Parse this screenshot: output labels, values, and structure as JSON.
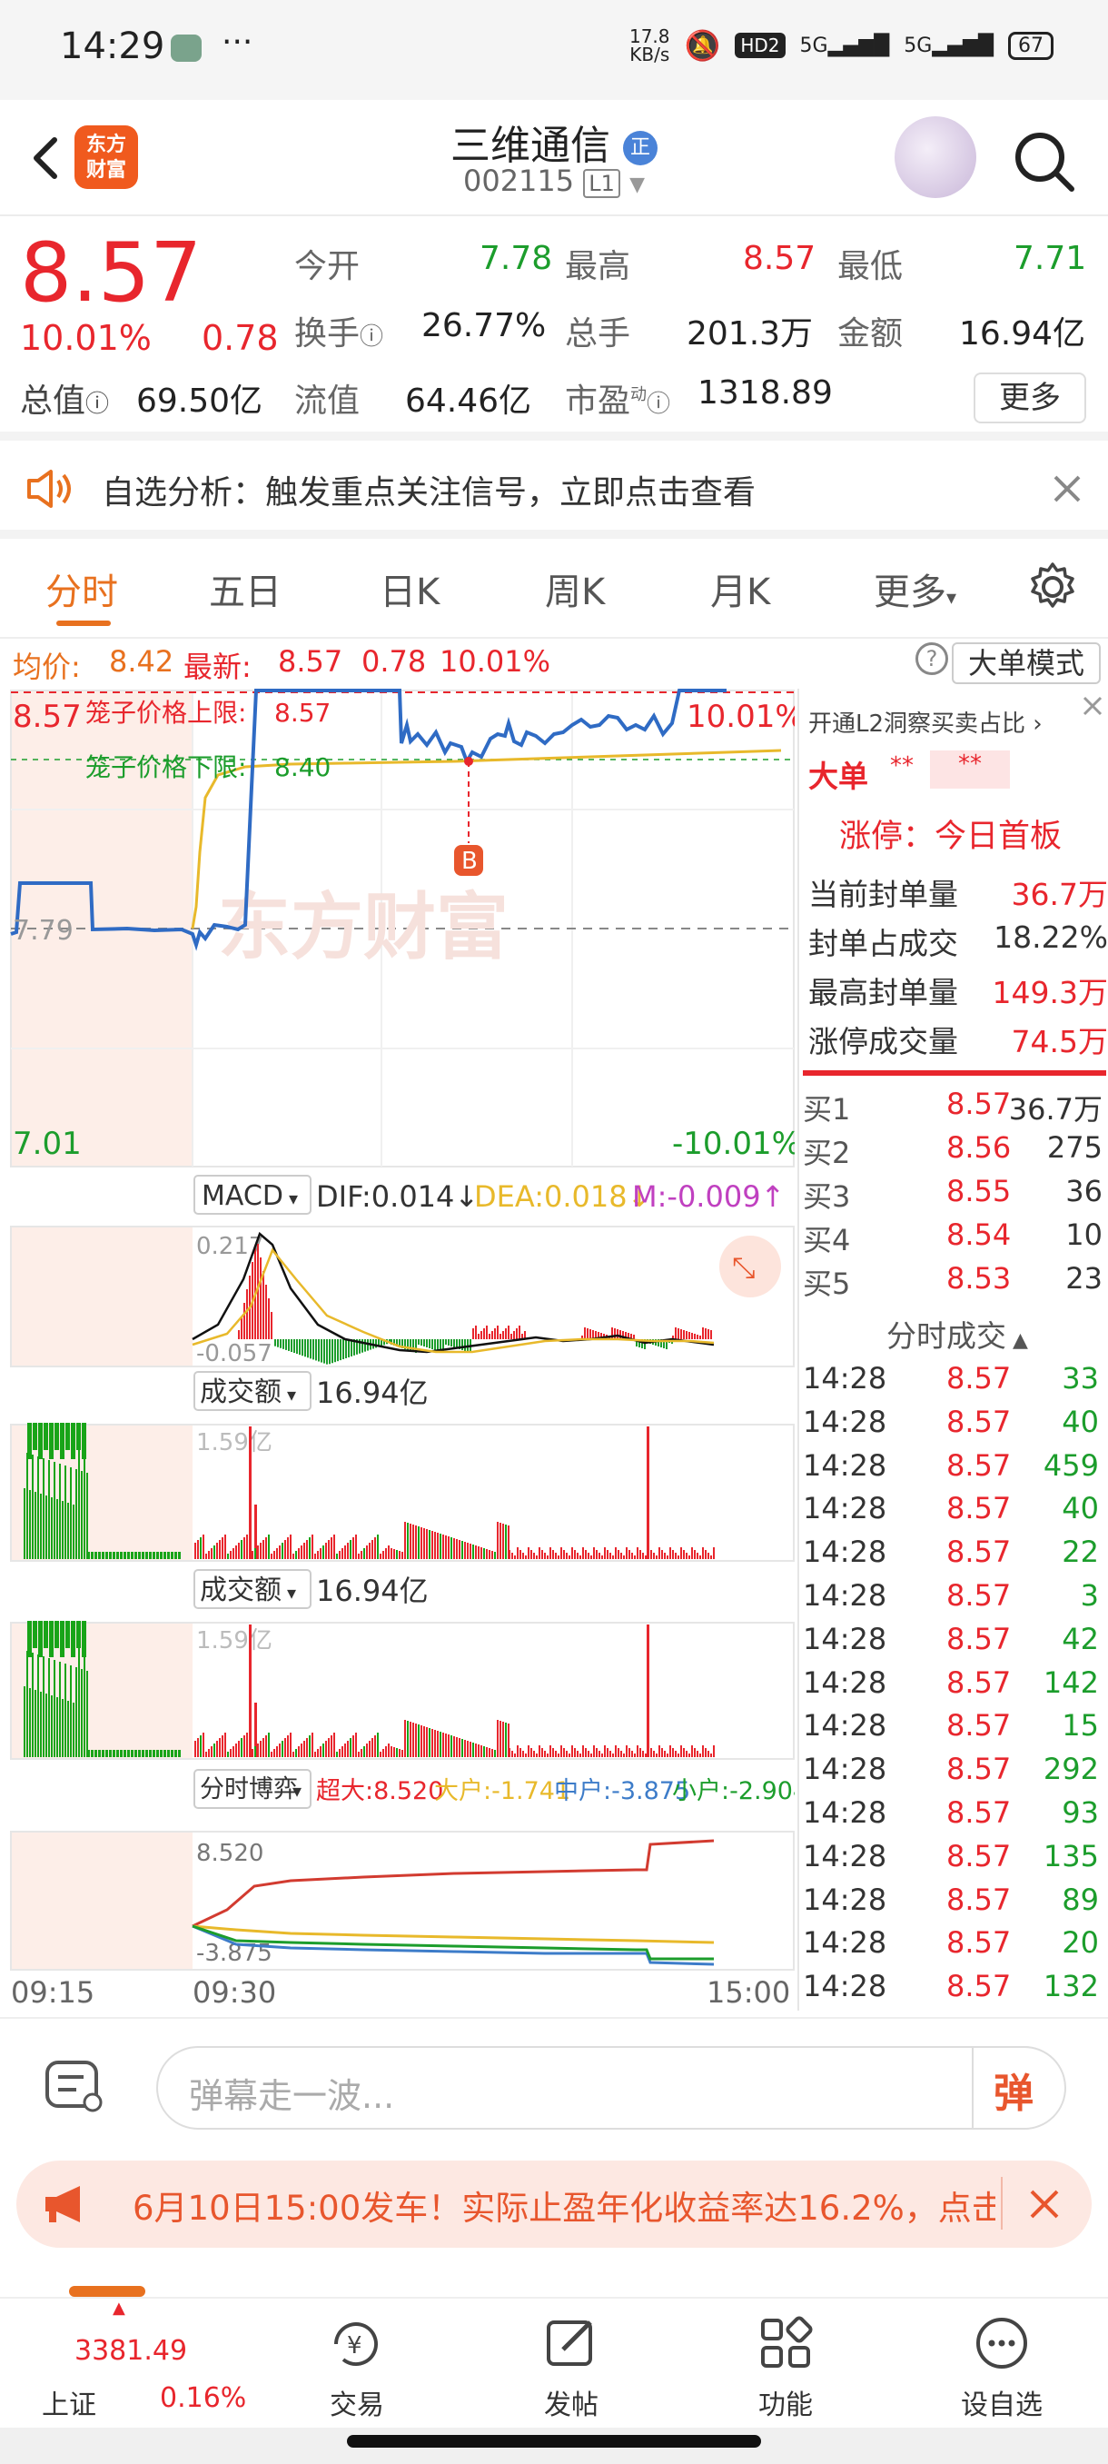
{
  "status_bar": {
    "time": "14:29",
    "net_speed_top": "17.8",
    "net_speed_bottom": "KB/s",
    "hd": "HD2",
    "signal1": "5G",
    "signal2": "5G",
    "battery": "67"
  },
  "header": {
    "logo_text_1": "东方",
    "logo_text_2": "财富",
    "stock_name": "三维通信",
    "stock_code": "002115",
    "level": "L1"
  },
  "quote": {
    "price": "8.57",
    "change_pct": "10.01%",
    "change": "0.78",
    "open_label": "今开",
    "open": "7.78",
    "high_label": "最高",
    "high": "8.57",
    "low_label": "最低",
    "low": "7.71",
    "turnover_label": "换手",
    "turnover": "26.77%",
    "volume_label": "总手",
    "volume": "201.3万",
    "amount_label": "金额",
    "amount": "16.94亿",
    "mcap_label": "总值",
    "mcap": "69.50亿",
    "float_label": "流值",
    "float": "64.46亿",
    "pe_label": "市盈",
    "pe_sup": "动",
    "pe": "1318.89",
    "more": "更多"
  },
  "notice": {
    "text": "自选分析：触发重点关注信号，立即点击查看"
  },
  "tabs": [
    "分时",
    "五日",
    "日K",
    "周K",
    "月K",
    "更多"
  ],
  "info_line": {
    "avg_label": "均价:",
    "avg": "8.42",
    "latest_label": "最新:",
    "latest": "8.57",
    "chg": "0.78",
    "pct": "10.01%",
    "big_order_mode": "大单模式"
  },
  "chart": {
    "top_price": "8.57",
    "top_pct": "10.01%",
    "upper_limit_label": "笼子价格上限:",
    "upper_limit": "8.57",
    "lower_limit_label": "笼子价格下限:",
    "lower_limit": "8.40",
    "prev_close": "7.79",
    "bottom_price": "7.01",
    "bottom_pct": "-10.01%",
    "watermark": "东方财富",
    "b_marker": "B",
    "macd_label": "MACD",
    "dif": "DIF:0.014↓",
    "dea": "DEA:0.018↓",
    "m": "M:-0.009↑",
    "macd_top": "0.217",
    "macd_bottom": "-0.057",
    "amount_label": "成交额",
    "amount_value": "16.94亿",
    "amount_top": "1.59亿",
    "amount_label2": "成交额",
    "amount_value2": "16.94亿",
    "amount_top2": "1.59亿",
    "flow_label": "分时博弈",
    "flow_super": "超大:8.520",
    "flow_large": "大户:-1.741",
    "flow_mid": "中户:-3.875",
    "flow_small": "小户:-2.904",
    "flow_top": "8.520",
    "flow_bottom": "-3.875",
    "time_start": "09:15",
    "time_open": "09:30",
    "time_end": "15:00"
  },
  "right_panel": {
    "l2_text": "开通L2洞察买卖占比",
    "big_order_label": "大单",
    "big_order_v1": "**",
    "big_order_v2": "**",
    "limit_status": "涨停：今日首板",
    "rows": [
      {
        "label": "当前封单量",
        "value": "36.7万"
      },
      {
        "label": "封单占成交",
        "value": "18.22%"
      },
      {
        "label": "最高封单量",
        "value": "149.3万"
      },
      {
        "label": "涨停成交量",
        "value": "74.5万"
      }
    ],
    "bids": [
      {
        "label": "买1",
        "price": "8.57",
        "vol": "36.7万"
      },
      {
        "label": "买2",
        "price": "8.56",
        "vol": "275"
      },
      {
        "label": "买3",
        "price": "8.55",
        "vol": "36"
      },
      {
        "label": "买4",
        "price": "8.54",
        "vol": "10"
      },
      {
        "label": "买5",
        "price": "8.53",
        "vol": "23"
      }
    ],
    "ticks_title": "分时成交",
    "ticks": [
      {
        "t": "14:28",
        "p": "8.57",
        "v": "33"
      },
      {
        "t": "14:28",
        "p": "8.57",
        "v": "40"
      },
      {
        "t": "14:28",
        "p": "8.57",
        "v": "459"
      },
      {
        "t": "14:28",
        "p": "8.57",
        "v": "40"
      },
      {
        "t": "14:28",
        "p": "8.57",
        "v": "22"
      },
      {
        "t": "14:28",
        "p": "8.57",
        "v": "3"
      },
      {
        "t": "14:28",
        "p": "8.57",
        "v": "42"
      },
      {
        "t": "14:28",
        "p": "8.57",
        "v": "142"
      },
      {
        "t": "14:28",
        "p": "8.57",
        "v": "15"
      },
      {
        "t": "14:28",
        "p": "8.57",
        "v": "292"
      },
      {
        "t": "14:28",
        "p": "8.57",
        "v": "93"
      },
      {
        "t": "14:28",
        "p": "8.57",
        "v": "135"
      },
      {
        "t": "14:28",
        "p": "8.57",
        "v": "89"
      },
      {
        "t": "14:28",
        "p": "8.57",
        "v": "20"
      },
      {
        "t": "14:28",
        "p": "8.57",
        "v": "132"
      }
    ]
  },
  "danmu": {
    "placeholder": "弹幕走一波...",
    "send": "弹"
  },
  "promo": {
    "text": "6月10日15:00发车！实际止盈年化收益率达16.2%，点击"
  },
  "bottom_nav": {
    "index_value": "3381.49",
    "index_name": "上证",
    "index_pct": "0.16%",
    "trade": "交易",
    "post": "发帖",
    "func": "功能",
    "watch": "设自选"
  },
  "colors": {
    "up": "#e8262d",
    "down": "#1c9d2c",
    "accent": "#e8711f",
    "price_line": "#2f6bc4",
    "avg_line": "#e8b92b"
  }
}
